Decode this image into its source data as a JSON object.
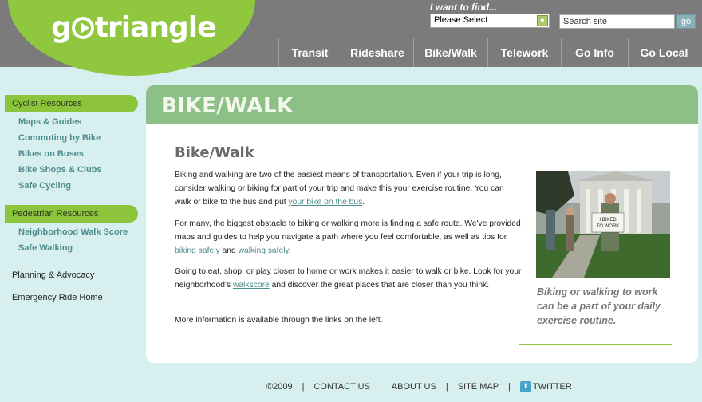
{
  "header": {
    "logo_text_left": "g",
    "logo_text_right": "triangle",
    "find_label": "I want to find...",
    "find_select_value": "Please Select",
    "search_placeholder": "Search site",
    "go_label": "go"
  },
  "nav": {
    "items": [
      "Transit",
      "Rideshare",
      "Bike/Walk",
      "Telework",
      "Go Info",
      "Go Local"
    ]
  },
  "sidebar": {
    "cyclist_heading": "Cyclist Resources",
    "cyclist_links": [
      "Maps & Guides",
      "Commuting by Bike",
      "Bikes on Buses",
      "Bike Shops & Clubs",
      "Safe Cycling"
    ],
    "pedestrian_heading": "Pedestrian Resources",
    "pedestrian_links": [
      "Neighborhood Walk Score",
      "Safe Walking"
    ],
    "planning": "Planning & Advocacy",
    "emergency": "Emergency Ride Home"
  },
  "main": {
    "banner": "BIKE/WALK",
    "title": "Bike/Walk",
    "p1_text": "Biking and walking are two of the easiest means of transportation.  Even if your trip is long, consider walking or biking for part of your trip and make this your exercise routine.  You can walk or bike to the bus and put ",
    "p1_link": "your bike on the bus",
    "p1_end": ".",
    "p2_text": "For many, the biggest obstacle to biking or walking more is finding a safe route.  We've provided maps and guides to help you navigate a path where you feel comfortable, as well as tips for ",
    "p2_link1": "biking safely",
    "p2_mid": " and ",
    "p2_link2": "walking safely",
    "p2_end": ".",
    "p3_text": "Going to eat, shop, or play closer to home or work makes it easier to walk or bike.  Look for your neighborhood's ",
    "p3_link": "walkscore",
    "p3_end": " and discover the great places that are closer than you think.",
    "p4_text": "More information is available through the links on the left.",
    "photo_sign": "I BIKED TO WORK",
    "caption": "Biking or walking to work can be a part of your daily exercise routine."
  },
  "footer": {
    "copyright": "©2009",
    "links": [
      "CONTACT US",
      "ABOUT US",
      "SITE MAP"
    ],
    "twitter": "TWITTER"
  }
}
